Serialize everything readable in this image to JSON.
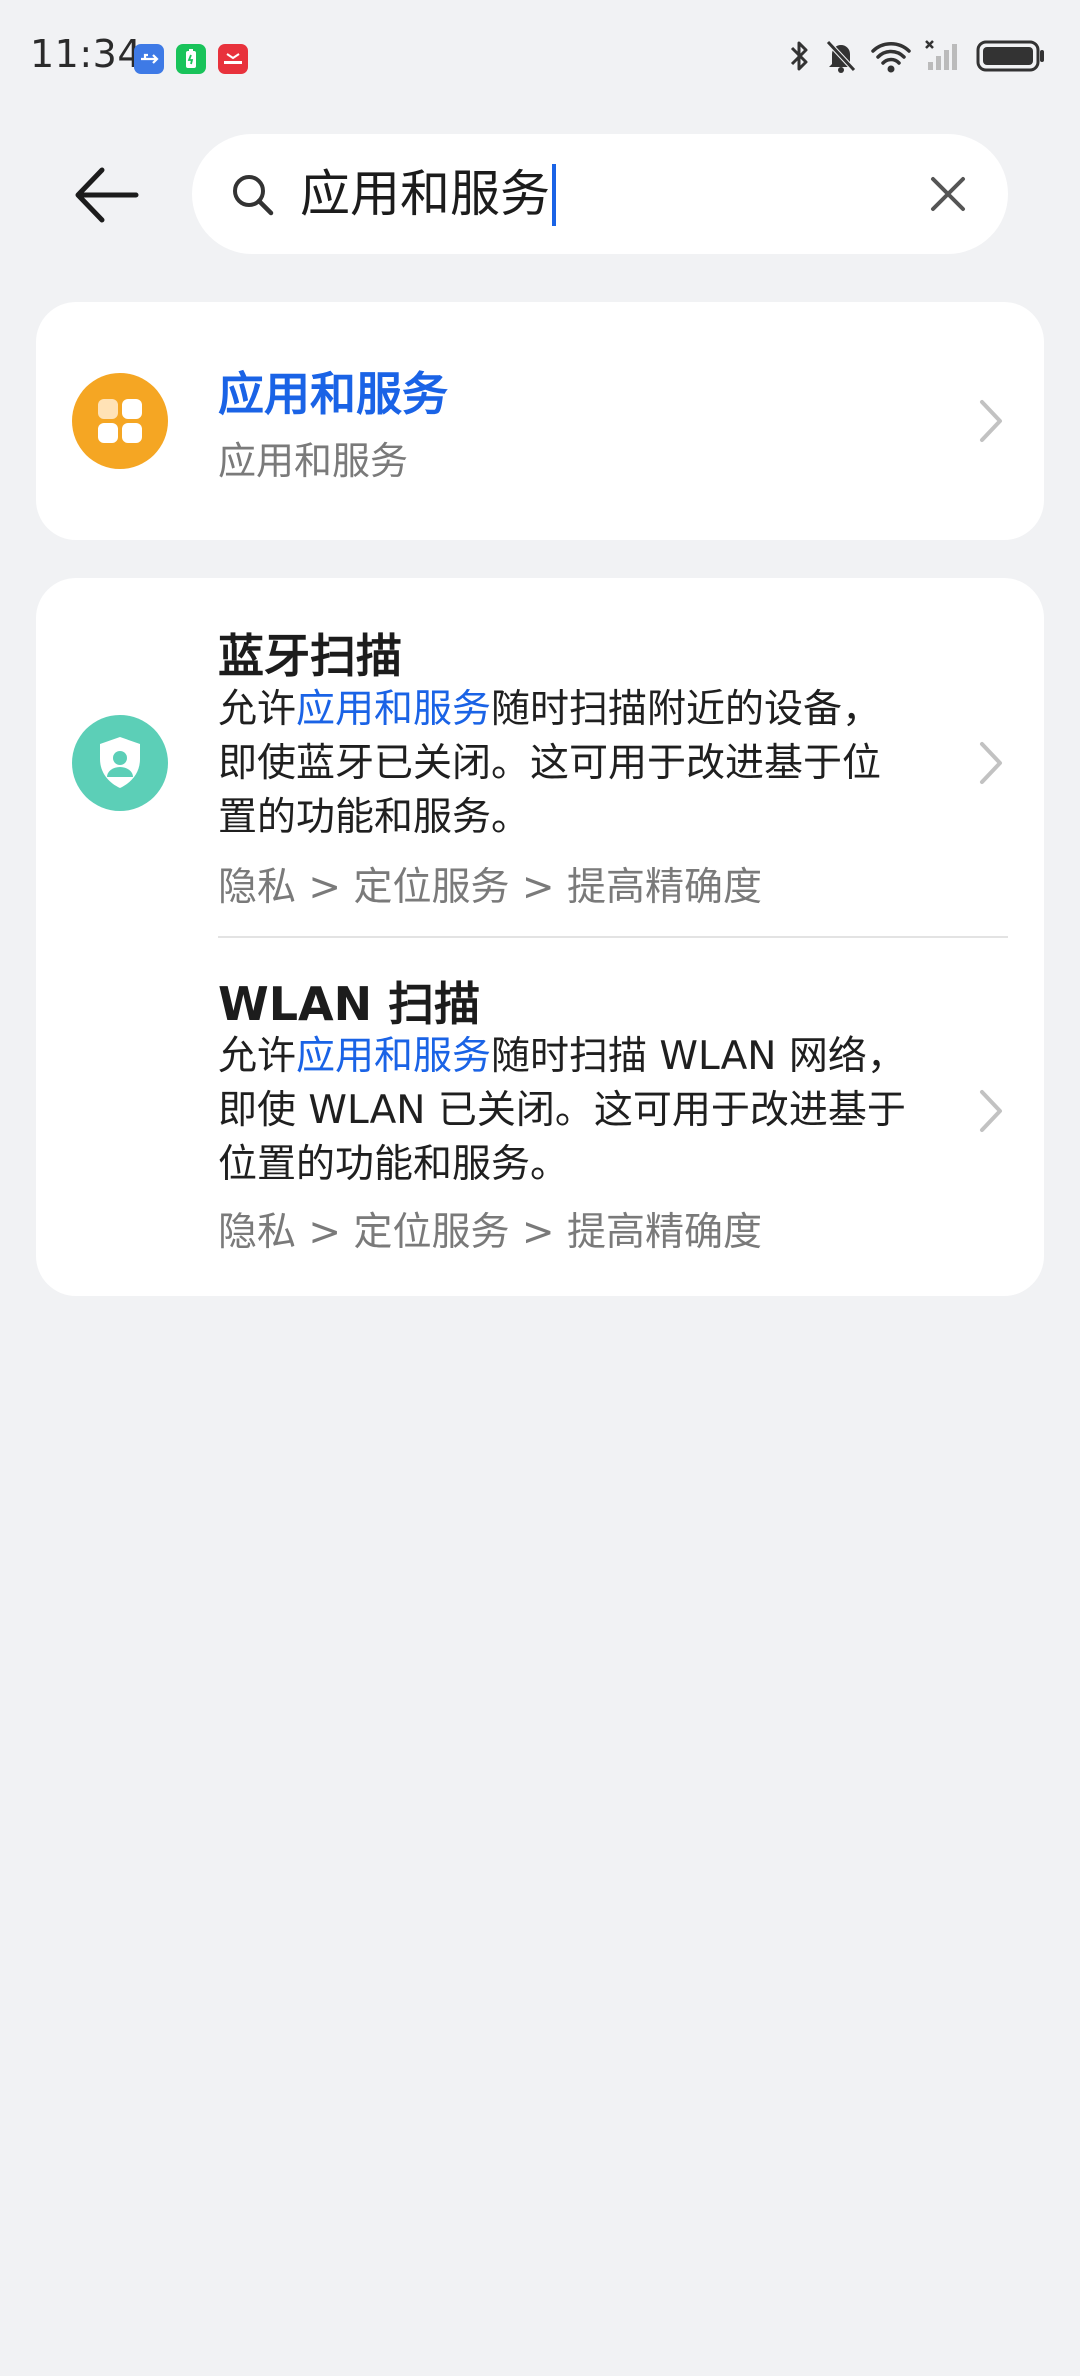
{
  "status_bar": {
    "time": "11:34",
    "icons": [
      "usb-icon",
      "battery-saver-icon",
      "red-app-icon",
      "bluetooth-icon",
      "mute-bell-icon",
      "wifi-icon",
      "signal-icon",
      "battery-icon"
    ]
  },
  "search": {
    "query": "应用和服务",
    "back_icon": "back-arrow-icon",
    "search_icon": "search-icon",
    "clear_icon": "close-icon"
  },
  "results": {
    "top": {
      "title": "应用和服务",
      "subtitle": "应用和服务",
      "icon": "apps-grid-icon",
      "icon_color": "#f5a623"
    },
    "items": [
      {
        "title": "蓝牙扫描",
        "desc_pre": "允许",
        "desc_highlight": "应用和服务",
        "desc_line1_rest": "随时扫描附近的设备，",
        "desc_line2": "即使蓝牙已关闭。这可用于改进基于位",
        "desc_line3": "置的功能和服务。",
        "path": "隐私 > 定位服务 > 提高精确度",
        "icon": "privacy-shield-icon",
        "icon_color": "#5ccfb7"
      },
      {
        "title": "WLAN 扫描",
        "desc_pre": "允许",
        "desc_highlight": "应用和服务",
        "desc_line1_rest": "随时扫描 WLAN 网络，",
        "desc_line2": "即使 WLAN 已关闭。这可用于改进基于",
        "desc_line3": "位置的功能和服务。",
        "path": "隐私 > 定位服务 > 提高精确度"
      }
    ]
  },
  "colors": {
    "accent": "#1a63e6",
    "background": "#f1f2f4"
  }
}
